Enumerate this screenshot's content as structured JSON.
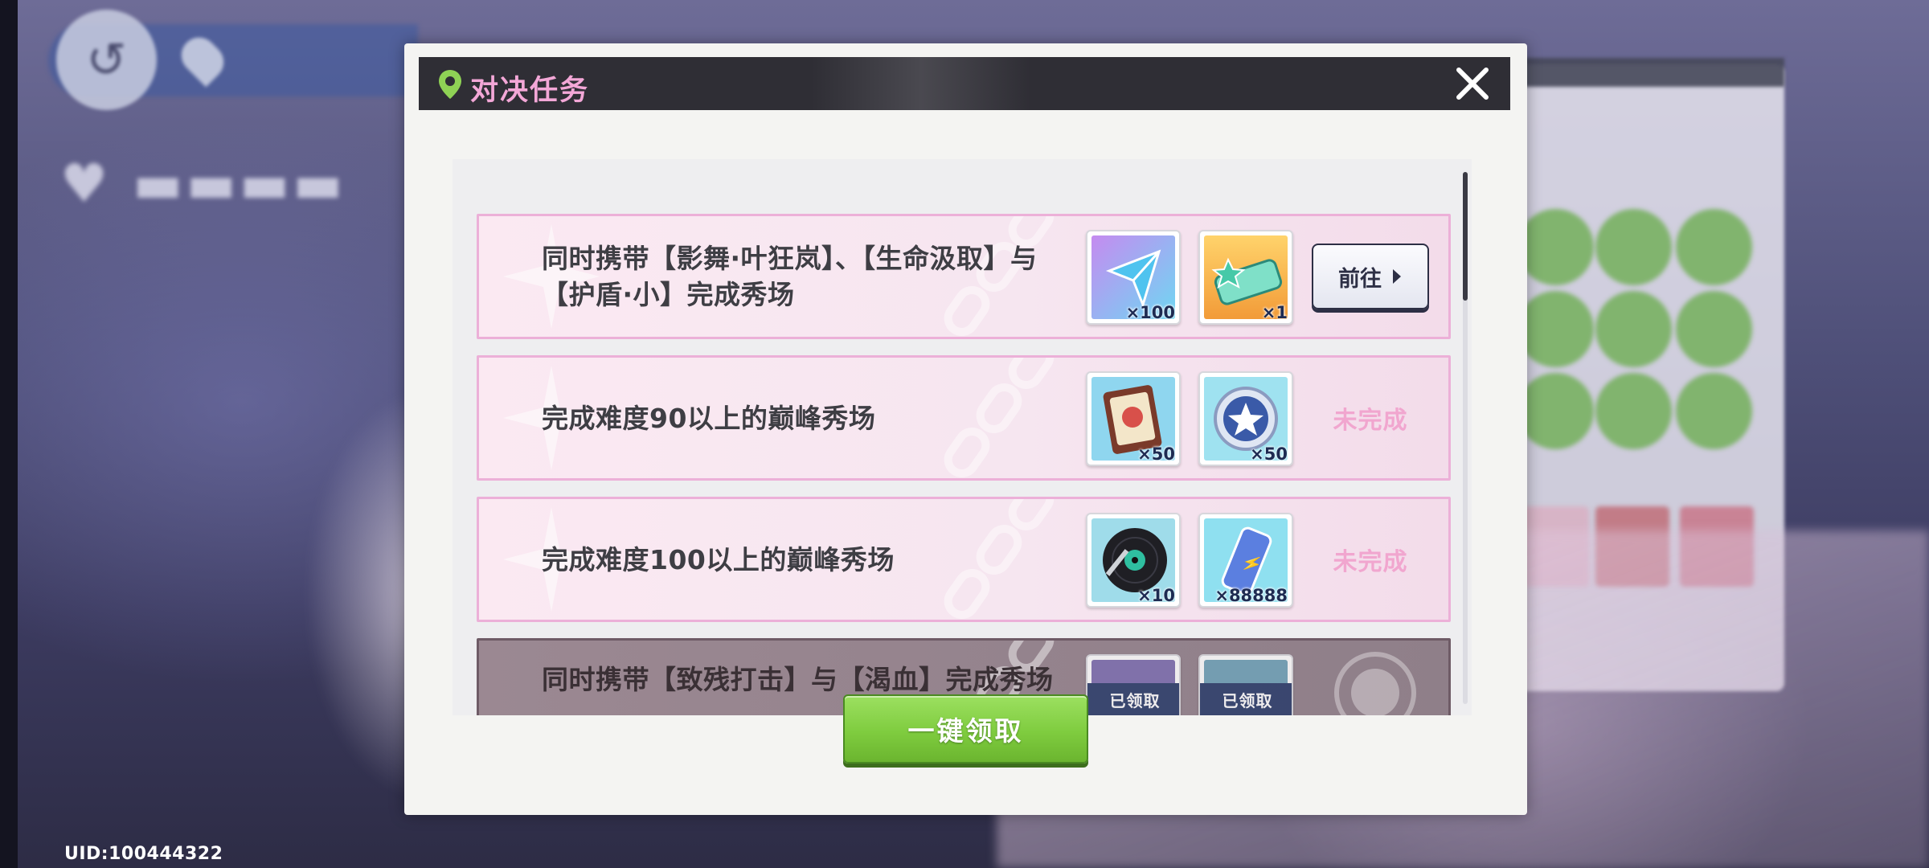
{
  "dialog": {
    "title": "对决任务",
    "claim_all_label": "一键领取"
  },
  "tasks": [
    {
      "text": "同时携带【影舞·叶狂岚】、【生命汲取】与【护盾·小】完成秀场",
      "rewards": [
        {
          "icon": "blue-crystal-icon",
          "qty": "×100"
        },
        {
          "icon": "green-ticket-icon",
          "qty": "×1"
        }
      ],
      "action": "前往"
    },
    {
      "text": "完成难度90以上的巅峰秀场",
      "rewards": [
        {
          "icon": "badge-card-icon",
          "qty": "×50"
        },
        {
          "icon": "star-coin-icon",
          "qty": "×50"
        }
      ],
      "status": "未完成"
    },
    {
      "text": "完成难度100以上的巅峰秀场",
      "rewards": [
        {
          "icon": "vinyl-record-icon",
          "qty": "×10"
        },
        {
          "icon": "energy-can-icon",
          "qty": "×88888"
        }
      ],
      "status": "未完成"
    },
    {
      "text": "同时携带【致残打击】与【渴血】完成秀场",
      "rewards": [
        {
          "icon": "claimed-reward-icon",
          "tag": "已领取"
        },
        {
          "icon": "claimed-reward-icon",
          "tag": "已领取"
        }
      ]
    }
  ],
  "footer": {
    "uid": "UID:100444322"
  },
  "colors": {
    "title_pink": "#f3a7d7",
    "status_pink": "#f1a6cf",
    "claim_green": "#7fcc3f",
    "header_dark": "#2f2e35"
  }
}
